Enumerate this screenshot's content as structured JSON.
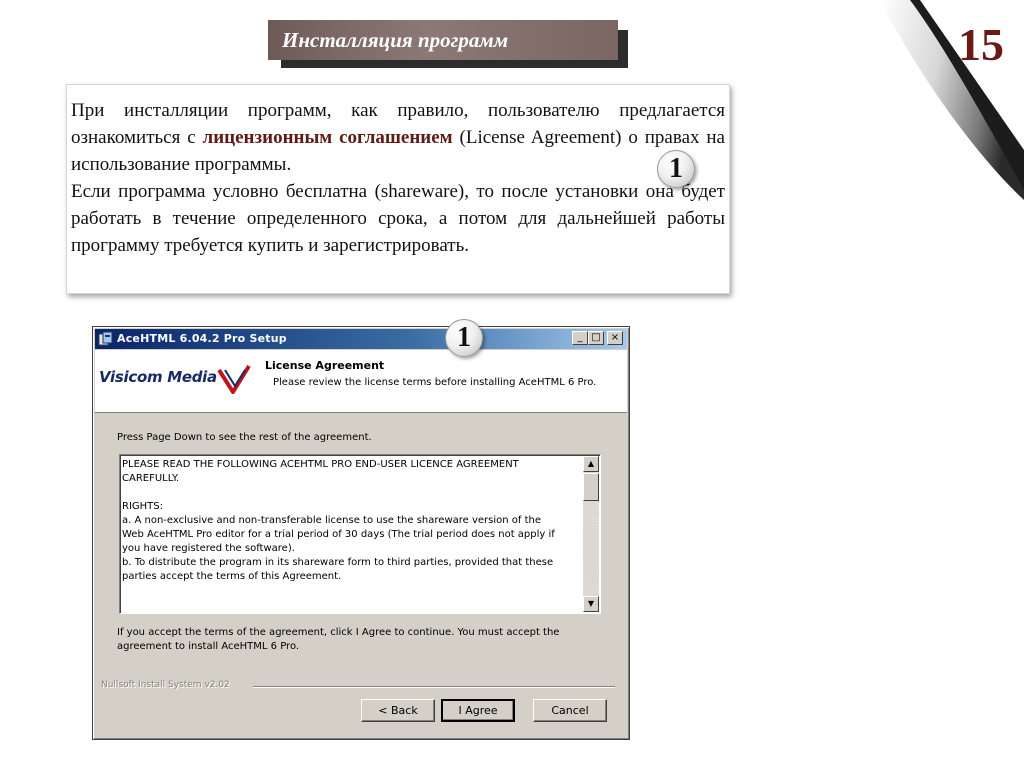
{
  "slide": {
    "title": "Инсталляция программ",
    "page_number": "15",
    "paragraph": {
      "part1": "При инсталляции программ, как правило, пользователю предлагается ознакомиться с ",
      "highlight": "лицензионным соглашением",
      "part2": " (License Agreement) о правах на использование программы.",
      "part3": "Если программа условно бесплатна (shareware), то после установки она будет работать в течение определенного срока, а потом для дальнейшей работы программу требуется купить и зарегистрировать."
    },
    "callout_badge": "1",
    "dialog_badge": "1",
    "colors": {
      "highlight": "#5e1a14",
      "page_number": "#6a1a14",
      "title_bar_bg": "#8c7874"
    }
  },
  "dialog": {
    "window_title": "AceHTML 6.04.2 Pro Setup",
    "controls": {
      "minimize": "_",
      "maximize": "□",
      "close": "×"
    },
    "logo": "Visicom Media",
    "header_title": "License Agreement",
    "header_subtitle": "Please review the license terms before installing AceHTML 6 Pro.",
    "instruction": "Press Page Down to see the rest of the agreement.",
    "license_text": "PLEASE READ THE FOLLOWING ACEHTML PRO END-USER LICENCE AGREEMENT\nCAREFULLY.\n\nRIGHTS:\na. A non-exclusive and non-transferable license to use the shareware version of the\nWeb AceHTML Pro editor for a trial period of 30 days (The trial period does not apply if\nyou have registered the software).\nb. To distribute the program in its shareware form to third parties, provided that these\nparties accept the terms of this Agreement.",
    "accept_text": "If you accept the terms of the agreement, click I Agree to continue. You must accept the agreement to install AceHTML 6 Pro.",
    "installer_label": "Nullsoft Install System v2.02",
    "buttons": {
      "back": "< Back",
      "agree": "I Agree",
      "cancel": "Cancel"
    },
    "scroll_up_icon": "▲",
    "scroll_down_icon": "▼",
    "colors": {
      "titlebar_start": "#0a246a",
      "titlebar_end": "#a6caf0",
      "face": "#d4d0c8"
    }
  }
}
